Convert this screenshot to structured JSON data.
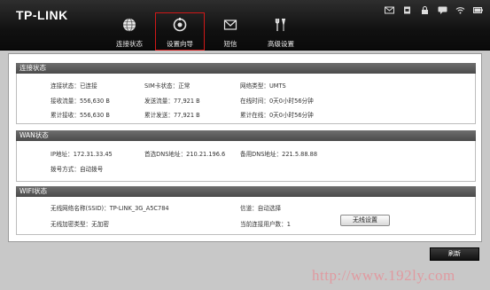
{
  "header": {
    "logo": "TP-LINK",
    "status_icons": [
      "mail-icon",
      "sim-icon",
      "lock-icon",
      "message-icon",
      "wifi-icon",
      "battery-icon"
    ]
  },
  "nav": {
    "items": [
      {
        "label": "连接状态",
        "icon": "globe-icon"
      },
      {
        "label": "设置向导",
        "icon": "gear-icon",
        "active": true
      },
      {
        "label": "短信",
        "icon": "envelope-icon"
      },
      {
        "label": "高级设置",
        "icon": "tools-icon"
      }
    ]
  },
  "connection": {
    "title": "连接状态",
    "conn_status": "连接状态：已连接",
    "sim_status": "SIM卡状态：正常",
    "net_type": "网络类型：UMTS",
    "recv_flow": "接收流量：556,630 B",
    "send_flow": "发送流量：77,921 B",
    "online_time": "在线时间：0天0小时56分钟",
    "total_recv": "累计接收：556,630 B",
    "total_send": "累计发送：77,921 B",
    "total_online": "累计在线：0天0小时56分钟"
  },
  "wan": {
    "title": "WAN状态",
    "ip": "IP地址：172.31.33.45",
    "dns1": "首选DNS地址：210.21.196.6",
    "dns2": "备用DNS地址：221.5.88.88",
    "dial_mode": "拨号方式：自动拨号"
  },
  "wifi": {
    "title": "WIFI状态",
    "ssid": "无线网络名称(SSID)：TP-LINK_3G_A5C784",
    "channel": "信道：自动选择",
    "encryption": "无线加密类型：无加密",
    "users": "当前连接用户数：1",
    "settings_button": "无线设置"
  },
  "footer": {
    "refresh_button": "刷新",
    "watermark": "http://www.192ly.com"
  },
  "colors": {
    "header_bg": "#111111",
    "section_bg": "#555555",
    "active_border": "#d01818",
    "watermark": "#e09aa0"
  }
}
